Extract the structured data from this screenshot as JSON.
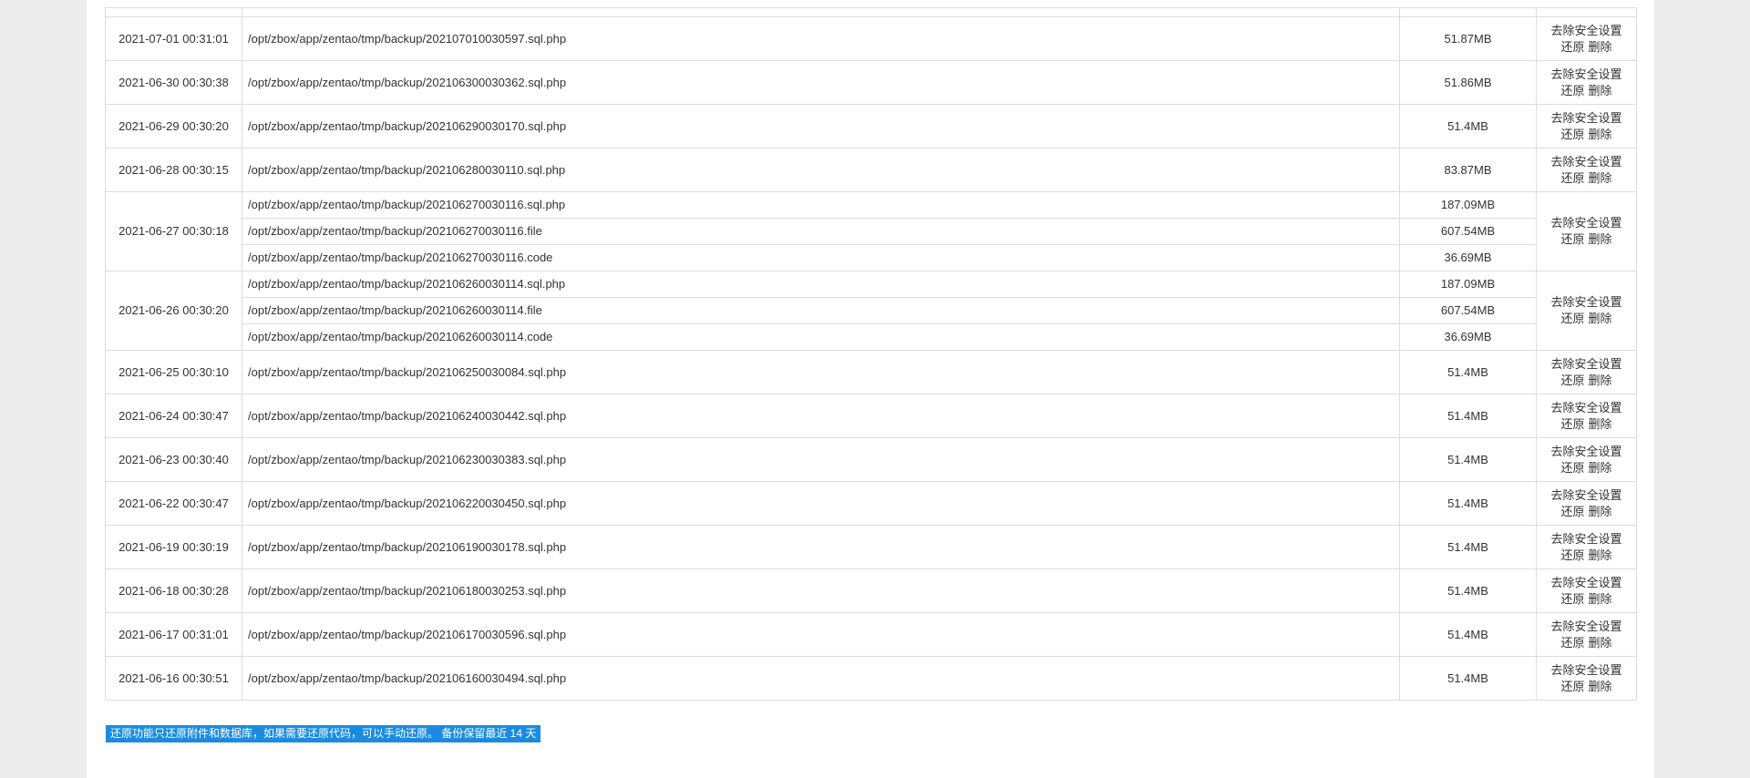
{
  "actions": {
    "remove_safe": "去除安全设置",
    "restore": "还原",
    "delete": "删除"
  },
  "backups": [
    {
      "time": "2021-07-01 00:31:01",
      "files": [
        {
          "path": "/opt/zbox/app/zentao/tmp/backup/202107010030597.sql.php",
          "size": "51.87MB"
        }
      ]
    },
    {
      "time": "2021-06-30 00:30:38",
      "files": [
        {
          "path": "/opt/zbox/app/zentao/tmp/backup/202106300030362.sql.php",
          "size": "51.86MB"
        }
      ]
    },
    {
      "time": "2021-06-29 00:30:20",
      "files": [
        {
          "path": "/opt/zbox/app/zentao/tmp/backup/202106290030170.sql.php",
          "size": "51.4MB"
        }
      ]
    },
    {
      "time": "2021-06-28 00:30:15",
      "files": [
        {
          "path": "/opt/zbox/app/zentao/tmp/backup/202106280030110.sql.php",
          "size": "83.87MB"
        }
      ]
    },
    {
      "time": "2021-06-27 00:30:18",
      "files": [
        {
          "path": "/opt/zbox/app/zentao/tmp/backup/202106270030116.sql.php",
          "size": "187.09MB"
        },
        {
          "path": "/opt/zbox/app/zentao/tmp/backup/202106270030116.file",
          "size": "607.54MB"
        },
        {
          "path": "/opt/zbox/app/zentao/tmp/backup/202106270030116.code",
          "size": "36.69MB"
        }
      ]
    },
    {
      "time": "2021-06-26 00:30:20",
      "files": [
        {
          "path": "/opt/zbox/app/zentao/tmp/backup/202106260030114.sql.php",
          "size": "187.09MB"
        },
        {
          "path": "/opt/zbox/app/zentao/tmp/backup/202106260030114.file",
          "size": "607.54MB"
        },
        {
          "path": "/opt/zbox/app/zentao/tmp/backup/202106260030114.code",
          "size": "36.69MB"
        }
      ]
    },
    {
      "time": "2021-06-25 00:30:10",
      "files": [
        {
          "path": "/opt/zbox/app/zentao/tmp/backup/202106250030084.sql.php",
          "size": "51.4MB"
        }
      ]
    },
    {
      "time": "2021-06-24 00:30:47",
      "files": [
        {
          "path": "/opt/zbox/app/zentao/tmp/backup/202106240030442.sql.php",
          "size": "51.4MB"
        }
      ]
    },
    {
      "time": "2021-06-23 00:30:40",
      "files": [
        {
          "path": "/opt/zbox/app/zentao/tmp/backup/202106230030383.sql.php",
          "size": "51.4MB"
        }
      ]
    },
    {
      "time": "2021-06-22 00:30:47",
      "files": [
        {
          "path": "/opt/zbox/app/zentao/tmp/backup/202106220030450.sql.php",
          "size": "51.4MB"
        }
      ]
    },
    {
      "time": "2021-06-19 00:30:19",
      "files": [
        {
          "path": "/opt/zbox/app/zentao/tmp/backup/202106190030178.sql.php",
          "size": "51.4MB"
        }
      ]
    },
    {
      "time": "2021-06-18 00:30:28",
      "files": [
        {
          "path": "/opt/zbox/app/zentao/tmp/backup/202106180030253.sql.php",
          "size": "51.4MB"
        }
      ]
    },
    {
      "time": "2021-06-17 00:31:01",
      "files": [
        {
          "path": "/opt/zbox/app/zentao/tmp/backup/202106170030596.sql.php",
          "size": "51.4MB"
        }
      ]
    },
    {
      "time": "2021-06-16 00:30:51",
      "files": [
        {
          "path": "/opt/zbox/app/zentao/tmp/backup/202106160030494.sql.php",
          "size": "51.4MB"
        }
      ]
    }
  ],
  "notice": "还原功能只还原附件和数据库，如果需要还原代码，可以手动还原。 备份保留最近 14 天"
}
